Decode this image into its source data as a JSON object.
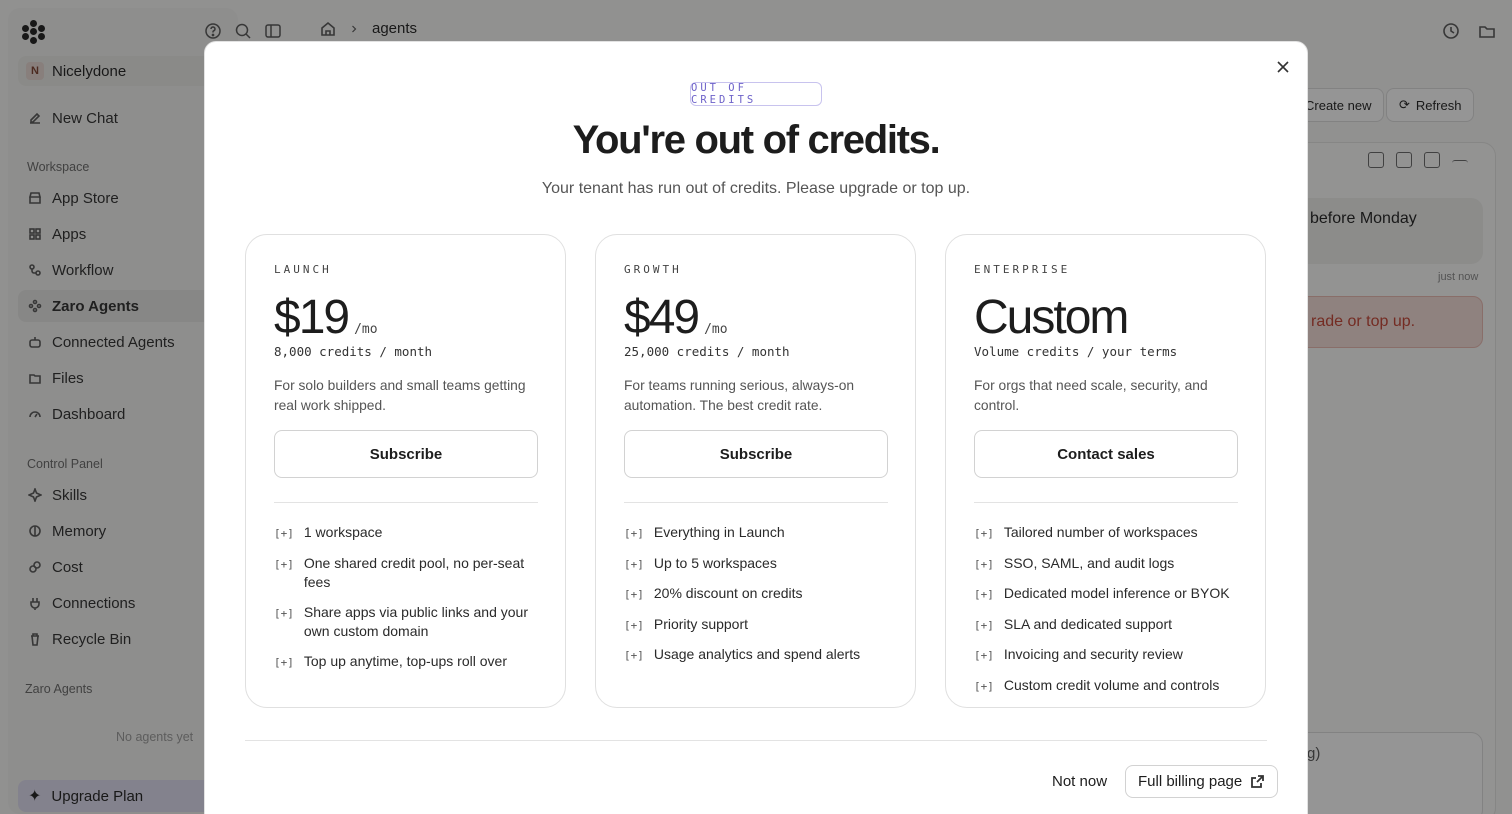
{
  "sidebar": {
    "workspace": {
      "initial": "N",
      "name": "Nicelydone"
    },
    "new_chat": "New Chat",
    "section_workspace": "Workspace",
    "workspace_items": [
      "App Store",
      "Apps",
      "Workflow",
      "Zaro Agents",
      "Connected Agents",
      "Files",
      "Dashboard"
    ],
    "active_item": "Zaro Agents",
    "section_control": "Control Panel",
    "control_items": [
      "Skills",
      "Memory",
      "Cost",
      "Connections",
      "Recycle Bin"
    ],
    "section_agents": "Zaro Agents",
    "agents_empty": "No agents yet",
    "upgrade": "Upgrade Plan"
  },
  "breadcrumb": {
    "current": "agents"
  },
  "background": {
    "create_new": "Create new",
    "refresh": "Refresh",
    "message_fragment": "before Monday",
    "message_time": "just now",
    "error_fragment": "rade or top up.",
    "input_fragment": "g)"
  },
  "modal": {
    "tag": "OUT OF CREDITS",
    "title": "You're out of credits.",
    "subtitle": "Your tenant has run out of credits. Please upgrade or top up.",
    "feature_marker": "[+]",
    "plans": [
      {
        "name": "LAUNCH",
        "price": "$19",
        "per": "/mo",
        "credits": "8,000 credits / month",
        "description": "For solo builders and small teams getting real work shipped.",
        "cta": "Subscribe",
        "features": [
          "1 workspace",
          "One shared credit pool, no per-seat fees",
          "Share apps via public links and your own custom domain",
          "Top up anytime, top-ups roll over"
        ]
      },
      {
        "name": "GROWTH",
        "price": "$49",
        "per": "/mo",
        "credits": "25,000 credits / month",
        "description": "For teams running serious, always-on automation. The best credit rate.",
        "cta": "Subscribe",
        "features": [
          "Everything in Launch",
          "Up to 5 workspaces",
          "20% discount on credits",
          "Priority support",
          "Usage analytics and spend alerts"
        ]
      },
      {
        "name": "ENTERPRISE",
        "price": "Custom",
        "per": "",
        "credits": "Volume credits / your terms",
        "description": "For orgs that need scale, security, and control.",
        "cta": "Contact sales",
        "features": [
          "Tailored number of workspaces",
          "SSO, SAML, and audit logs",
          "Dedicated model inference or BYOK",
          "SLA and dedicated support",
          "Invoicing and security review",
          "Custom credit volume and controls"
        ]
      }
    ],
    "not_now": "Not now",
    "billing": "Full billing page"
  }
}
